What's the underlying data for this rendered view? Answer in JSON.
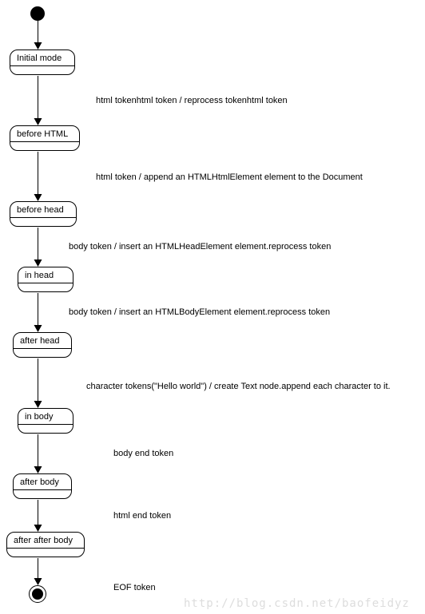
{
  "states": {
    "initial": "Initial mode",
    "beforeHtml": "before HTML",
    "beforeHead": "before head",
    "inHead": "in head",
    "afterHead": "after head",
    "inBody": "in body",
    "afterBody": "after body",
    "afterAfterBody": "after after body"
  },
  "transitions": {
    "t1": "html tokenhtml token / reprocess tokenhtml token",
    "t2": "html token / append an HTMLHtmlElement element to the Document",
    "t3": "body token / insert an HTMLHeadElement element.reprocess token",
    "t4": "body token / insert an HTMLBodyElement element.reprocess token",
    "t5": "character tokens(\"Hello world\") / create Text node.append each character to it.",
    "t6": "body end token",
    "t7": "html end token",
    "t8": "EOF token"
  },
  "watermark": "http://blog.csdn.net/baofeidyz"
}
